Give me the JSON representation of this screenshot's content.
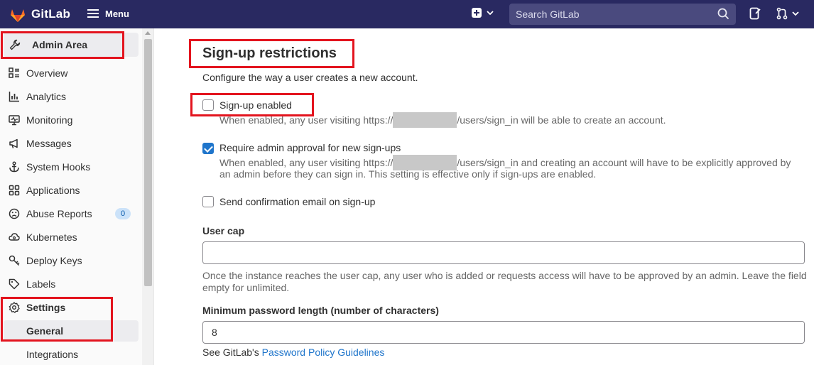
{
  "topbar": {
    "logo_text": "GitLab",
    "menu_label": "Menu",
    "search_placeholder": "Search GitLab"
  },
  "sidebar": {
    "header": "Admin Area",
    "items": [
      {
        "label": "Overview",
        "icon": "overview-icon"
      },
      {
        "label": "Analytics",
        "icon": "chart-icon"
      },
      {
        "label": "Monitoring",
        "icon": "monitor-icon"
      },
      {
        "label": "Messages",
        "icon": "bullhorn-icon"
      },
      {
        "label": "System Hooks",
        "icon": "anchor-icon"
      },
      {
        "label": "Applications",
        "icon": "applications-icon"
      },
      {
        "label": "Abuse Reports",
        "icon": "abuse-icon",
        "badge": "0"
      },
      {
        "label": "Kubernetes",
        "icon": "kubernetes-icon"
      },
      {
        "label": "Deploy Keys",
        "icon": "key-icon"
      },
      {
        "label": "Labels",
        "icon": "label-icon"
      },
      {
        "label": "Settings",
        "icon": "settings-icon"
      }
    ],
    "settings_sub": [
      {
        "label": "General",
        "active": true
      },
      {
        "label": "Integrations",
        "active": false
      }
    ]
  },
  "main": {
    "title": "Sign-up restrictions",
    "description": "Configure the way a user creates a new account.",
    "signup_enabled": {
      "label": "Sign-up enabled",
      "checked": false,
      "help_before": "When enabled, any user visiting https://",
      "help_after": "/users/sign_in will be able to create an account."
    },
    "admin_approval": {
      "label": "Require admin approval for new sign-ups",
      "checked": true,
      "help_before": "When enabled, any user visiting https://",
      "help_after": "/users/sign_in and creating an account will have to be explicitly approved by",
      "help_line2": "an admin before they can sign in. This setting is effective only if sign-ups are enabled."
    },
    "confirmation_email": {
      "label": "Send confirmation email on sign-up",
      "checked": false
    },
    "user_cap": {
      "label": "User cap",
      "value": "",
      "help_line1": "Once the instance reaches the user cap, any user who is added or requests access will have to be approved by an admin. Leave the field",
      "help_line2": "empty for unlimited."
    },
    "min_password": {
      "label": "Minimum password length (number of characters)",
      "value": "8",
      "help_prefix": "See GitLab's ",
      "help_link": "Password Policy Guidelines"
    }
  },
  "colors": {
    "topbar": "#292961",
    "accent": "#1f75cb",
    "annotation": "#e3141e"
  }
}
